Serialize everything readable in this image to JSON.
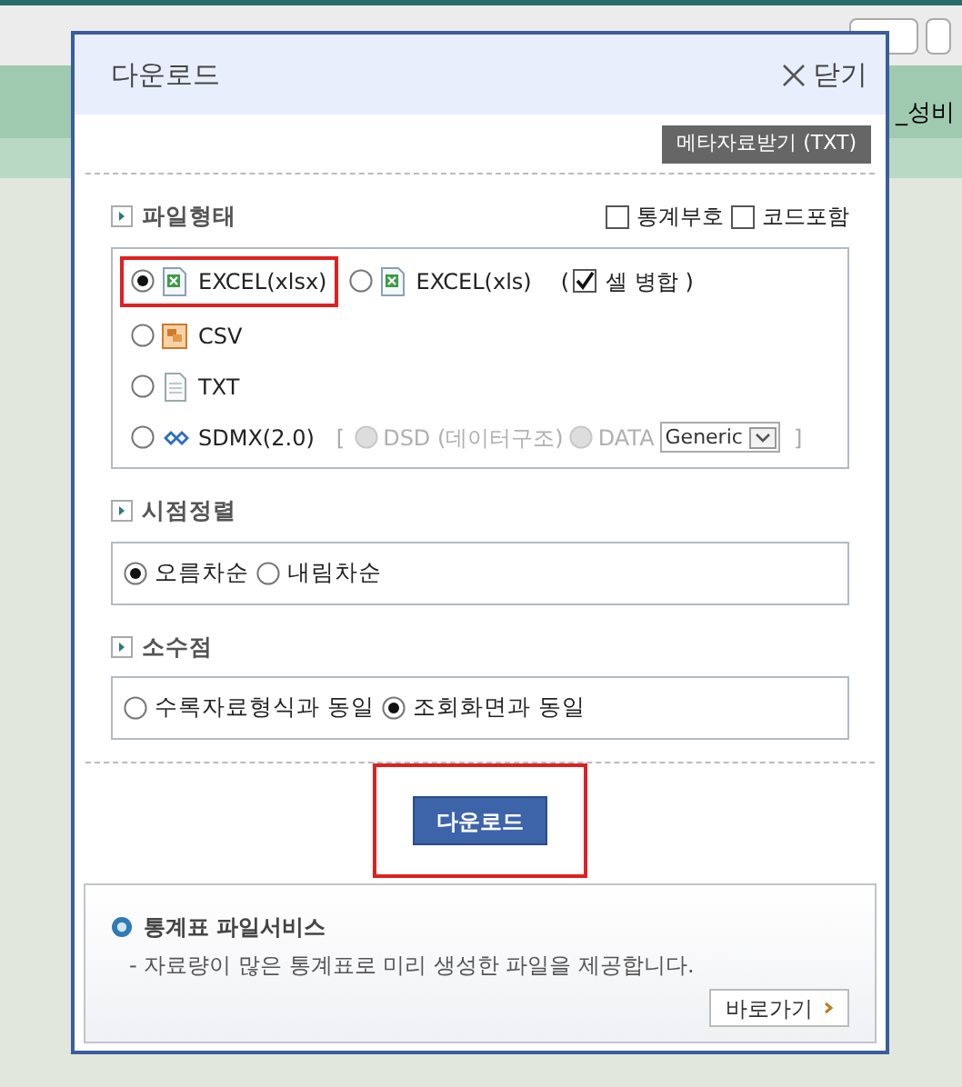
{
  "background": {
    "column_header": "_성비"
  },
  "dialog": {
    "title": "다운로드",
    "close_label": "닫기",
    "metadata_button": "메타자료받기 (TXT)",
    "file_format": {
      "title": "파일형태",
      "options": [
        {
          "label": "통계부호",
          "checked": false
        },
        {
          "label": "코드포함",
          "checked": false
        }
      ],
      "formats": [
        {
          "kind": "excel",
          "label": "EXCEL(xlsx)",
          "selected": true,
          "highlighted": true
        },
        {
          "kind": "excel",
          "label": "EXCEL(xls)",
          "selected": false,
          "highlighted": false
        },
        {
          "kind": "csv",
          "label": "CSV",
          "selected": false,
          "highlighted": false
        },
        {
          "kind": "txt",
          "label": "TXT",
          "selected": false,
          "highlighted": false
        },
        {
          "kind": "sdmx",
          "label": "SDMX(2.0)",
          "selected": false,
          "highlighted": false
        }
      ],
      "merge_cells": {
        "open": "(",
        "label": "셀 병합 )",
        "checked": true
      },
      "sdmx_options": {
        "open": "[",
        "close": "]",
        "select": "Generic",
        "choices": [
          {
            "label": "DSD (데이터구조)",
            "selected": false,
            "disabled": true
          },
          {
            "label": "DATA",
            "selected": false,
            "disabled": true
          }
        ]
      }
    },
    "sort": {
      "title": "시점정렬",
      "options": [
        {
          "label": "오름차순",
          "selected": true
        },
        {
          "label": "내림차순",
          "selected": false
        }
      ]
    },
    "decimal": {
      "title": "소수점",
      "options": [
        {
          "label": "수록자료형식과 동일",
          "selected": false
        },
        {
          "label": "조회화면과 동일",
          "selected": true
        }
      ]
    },
    "download_button": {
      "label": "다운로드",
      "highlighted": true
    },
    "file_service": {
      "title": "통계표 파일서비스",
      "description": "- 자료량이 많은 통계표로 미리 생성한 파일을 제공합니다.",
      "link": "바로가기"
    }
  }
}
